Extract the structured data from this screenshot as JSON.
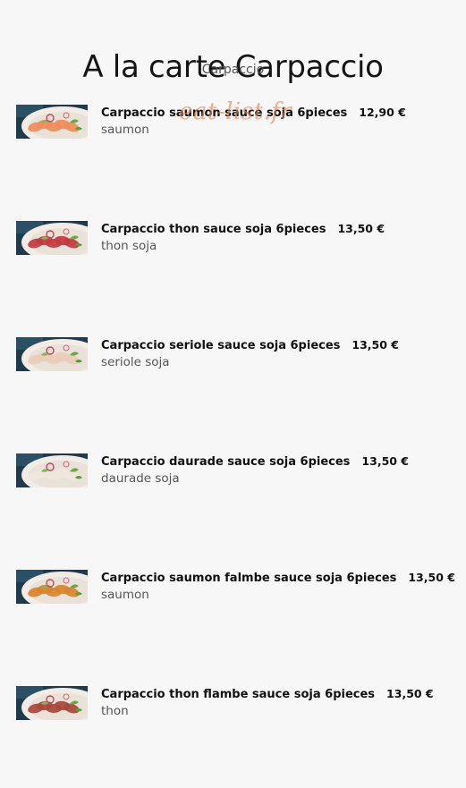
{
  "header": {
    "title": "A la carte Carpaccio",
    "subtitle": "Carpaccio"
  },
  "watermark": "eat-list.fr",
  "items": [
    {
      "name": "Carpaccio saumon sauce soja 6pieces",
      "price": "12,90 €",
      "description": "saumon",
      "image_icon": "salmon-carpaccio-image",
      "fish_color": "#ef8c5a"
    },
    {
      "name": "Carpaccio thon sauce soja 6pieces",
      "price": "13,50 €",
      "description": "thon soja",
      "image_icon": "tuna-carpaccio-image",
      "fish_color": "#c23a3f"
    },
    {
      "name": "Carpaccio seriole sauce soja 6pieces",
      "price": "13,50 €",
      "description": "seriole soja",
      "image_icon": "yellowtail-carpaccio-image",
      "fish_color": "#e9ccb8"
    },
    {
      "name": "Carpaccio daurade sauce soja 6pieces",
      "price": "13,50 €",
      "description": "daurade soja",
      "image_icon": "sea-bream-carpaccio-image",
      "fish_color": "#efe6dc"
    },
    {
      "name": "Carpaccio saumon falmbe sauce soja 6pieces",
      "price": "13,50 €",
      "description": "saumon",
      "image_icon": "flambe-salmon-carpaccio-image",
      "fish_color": "#d8842d"
    },
    {
      "name": "Carpaccio thon flambe sauce soja 6pieces",
      "price": "13,50 €",
      "description": "thon",
      "image_icon": "flambe-tuna-carpaccio-image",
      "fish_color": "#a8463a"
    }
  ]
}
